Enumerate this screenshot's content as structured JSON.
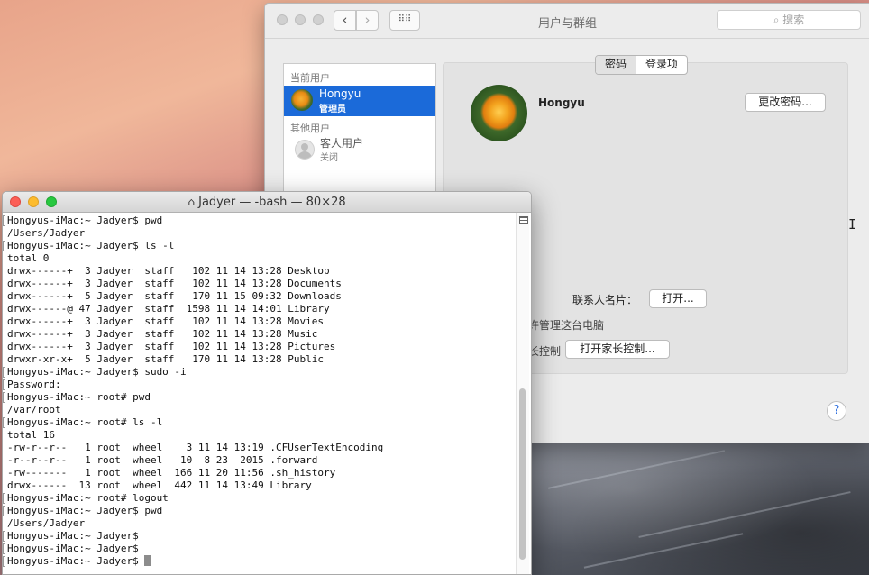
{
  "prefs": {
    "title": "用户与群组",
    "search_placeholder": "搜索",
    "list": {
      "current_header": "当前用户",
      "current_user": {
        "name": "Hongyu",
        "role": "管理员"
      },
      "other_header": "其他用户",
      "other_user": {
        "name": "客人用户",
        "status": "关闭"
      }
    },
    "tabs": [
      "密码",
      "登录项"
    ],
    "user_name": "Hongyu",
    "change_password": "更改密码...",
    "contact_card_label": "联系人名片：",
    "open_button": "打开...",
    "allow_admin_partial": "许管理这台电脑",
    "parental_partial": "长控制",
    "parental_button": "打开家长控制...",
    "help": "?"
  },
  "terminal": {
    "title": "Jadyer — -bash — 80×28",
    "lines": [
      {
        "text": "Hongyus-iMac:~ Jadyer$ pwd",
        "mark": true
      },
      {
        "text": "/Users/Jadyer",
        "mark": false
      },
      {
        "text": "Hongyus-iMac:~ Jadyer$ ls -l",
        "mark": true
      },
      {
        "text": "total 0",
        "mark": false
      },
      {
        "text": "drwx------+  3 Jadyer  staff   102 11 14 13:28 Desktop",
        "mark": false
      },
      {
        "text": "drwx------+  3 Jadyer  staff   102 11 14 13:28 Documents",
        "mark": false
      },
      {
        "text": "drwx------+  5 Jadyer  staff   170 11 15 09:32 Downloads",
        "mark": false
      },
      {
        "text": "drwx------@ 47 Jadyer  staff  1598 11 14 14:01 Library",
        "mark": false
      },
      {
        "text": "drwx------+  3 Jadyer  staff   102 11 14 13:28 Movies",
        "mark": false
      },
      {
        "text": "drwx------+  3 Jadyer  staff   102 11 14 13:28 Music",
        "mark": false
      },
      {
        "text": "drwx------+  3 Jadyer  staff   102 11 14 13:28 Pictures",
        "mark": false
      },
      {
        "text": "drwxr-xr-x+  5 Jadyer  staff   170 11 14 13:28 Public",
        "mark": false
      },
      {
        "text": "Hongyus-iMac:~ Jadyer$ sudo -i",
        "mark": true
      },
      {
        "text": "Password:",
        "mark": true
      },
      {
        "text": "Hongyus-iMac:~ root# pwd",
        "mark": true
      },
      {
        "text": "/var/root",
        "mark": false
      },
      {
        "text": "Hongyus-iMac:~ root# ls -l",
        "mark": true
      },
      {
        "text": "total 16",
        "mark": false
      },
      {
        "text": "-rw-r--r--   1 root  wheel    3 11 14 13:19 .CFUserTextEncoding",
        "mark": false
      },
      {
        "text": "-r--r--r--   1 root  wheel   10  8 23  2015 .forward",
        "mark": false
      },
      {
        "text": "-rw-------   1 root  wheel  166 11 20 11:56 .sh_history",
        "mark": false
      },
      {
        "text": "drwx------  13 root  wheel  442 11 14 13:49 Library",
        "mark": false
      },
      {
        "text": "Hongyus-iMac:~ root# logout",
        "mark": true
      },
      {
        "text": "Hongyus-iMac:~ Jadyer$ pwd",
        "mark": true
      },
      {
        "text": "/Users/Jadyer",
        "mark": false
      },
      {
        "text": "Hongyus-iMac:~ Jadyer$",
        "mark": true
      },
      {
        "text": "Hongyus-iMac:~ Jadyer$",
        "mark": true
      },
      {
        "text": "Hongyus-iMac:~ Jadyer$ ",
        "mark": true,
        "cursor": true
      }
    ]
  }
}
